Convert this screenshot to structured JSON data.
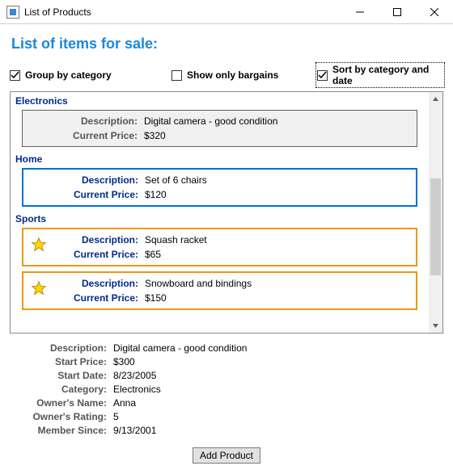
{
  "window": {
    "title": "List of Products"
  },
  "heading": "List of items for sale:",
  "options": {
    "group_by_category": {
      "label": "Group by category",
      "checked": true
    },
    "show_only_bargains": {
      "label": "Show only bargains",
      "checked": false
    },
    "sort_by_cat_date": {
      "label": "Sort by category and date",
      "checked": true,
      "focused": true
    }
  },
  "list": {
    "labels": {
      "description": "Description:",
      "price": "Current Price:"
    },
    "groups": [
      {
        "name": "Electronics",
        "items": [
          {
            "description": "Digital camera - good condition",
            "price": "$320",
            "style": "selected",
            "star": false
          }
        ]
      },
      {
        "name": "Home",
        "items": [
          {
            "description": "Set of 6 chairs",
            "price": "$120",
            "style": "blue",
            "star": false
          }
        ]
      },
      {
        "name": "Sports",
        "items": [
          {
            "description": "Squash racket",
            "price": "$65",
            "style": "orange",
            "star": true
          },
          {
            "description": "Snowboard and bindings",
            "price": "$150",
            "style": "orange",
            "star": true
          }
        ]
      }
    ]
  },
  "details": {
    "labels": {
      "description": "Description:",
      "start_price": "Start Price:",
      "start_date": "Start Date:",
      "category": "Category:",
      "owner_name": "Owner's Name:",
      "owner_rating": "Owner's Rating:",
      "member_since": "Member Since:"
    },
    "values": {
      "description": "Digital camera - good condition",
      "start_price": "$300",
      "start_date": "8/23/2005",
      "category": "Electronics",
      "owner_name": "Anna",
      "owner_rating": "5",
      "member_since": "9/13/2001"
    }
  },
  "buttons": {
    "add_product": "Add Product"
  }
}
